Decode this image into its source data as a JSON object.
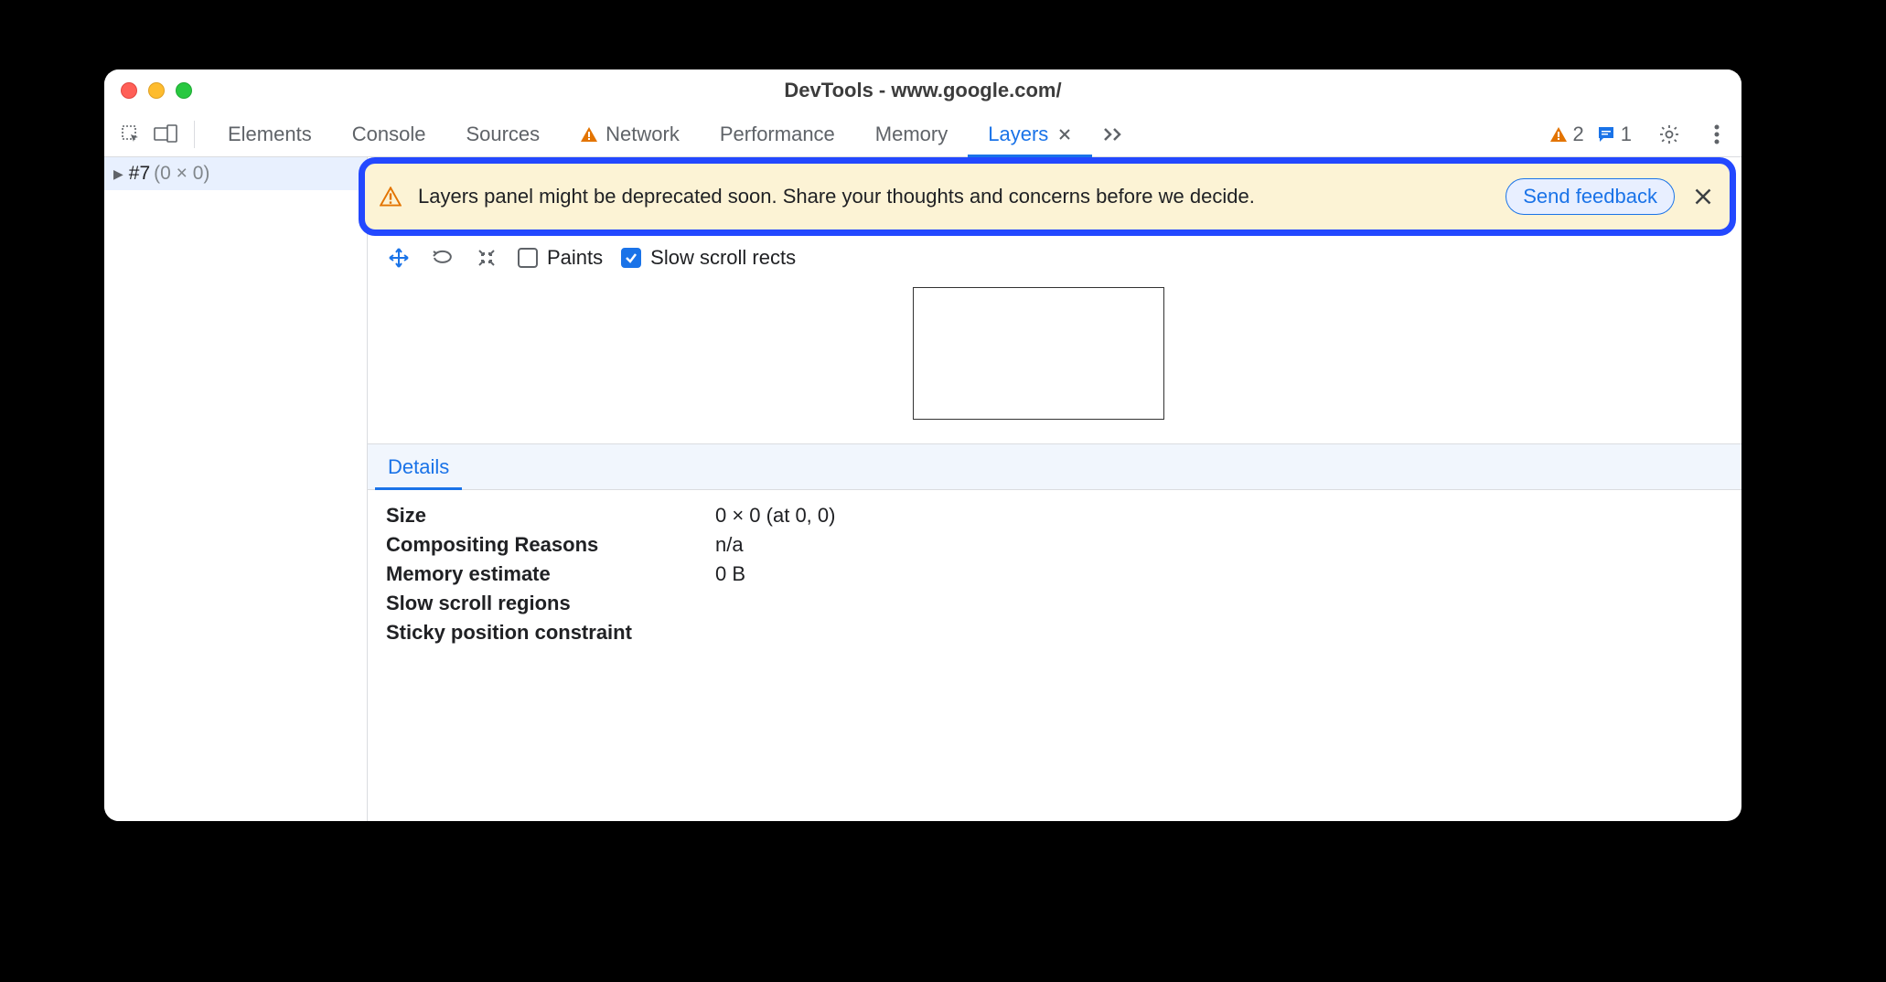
{
  "window": {
    "title": "DevTools - www.google.com/"
  },
  "tabs": {
    "elements": "Elements",
    "console": "Console",
    "sources": "Sources",
    "network": "Network",
    "performance": "Performance",
    "memory": "Memory",
    "layers": "Layers"
  },
  "counters": {
    "warnings": "2",
    "messages": "1"
  },
  "tree": {
    "item0_id": "#7",
    "item0_dim": "(0 × 0)"
  },
  "banner": {
    "text": "Layers panel might be deprecated soon. Share your thoughts and concerns before we decide.",
    "button": "Send feedback"
  },
  "viewer_toolbar": {
    "paints": "Paints",
    "slow_scroll": "Slow scroll rects"
  },
  "details": {
    "tab": "Details",
    "rows": {
      "size_k": "Size",
      "size_v": "0 × 0 (at 0, 0)",
      "comp_k": "Compositing Reasons",
      "comp_v": "n/a",
      "mem_k": "Memory estimate",
      "mem_v": "0 B",
      "slow_k": "Slow scroll regions",
      "slow_v": "",
      "sticky_k": "Sticky position constraint",
      "sticky_v": ""
    }
  }
}
